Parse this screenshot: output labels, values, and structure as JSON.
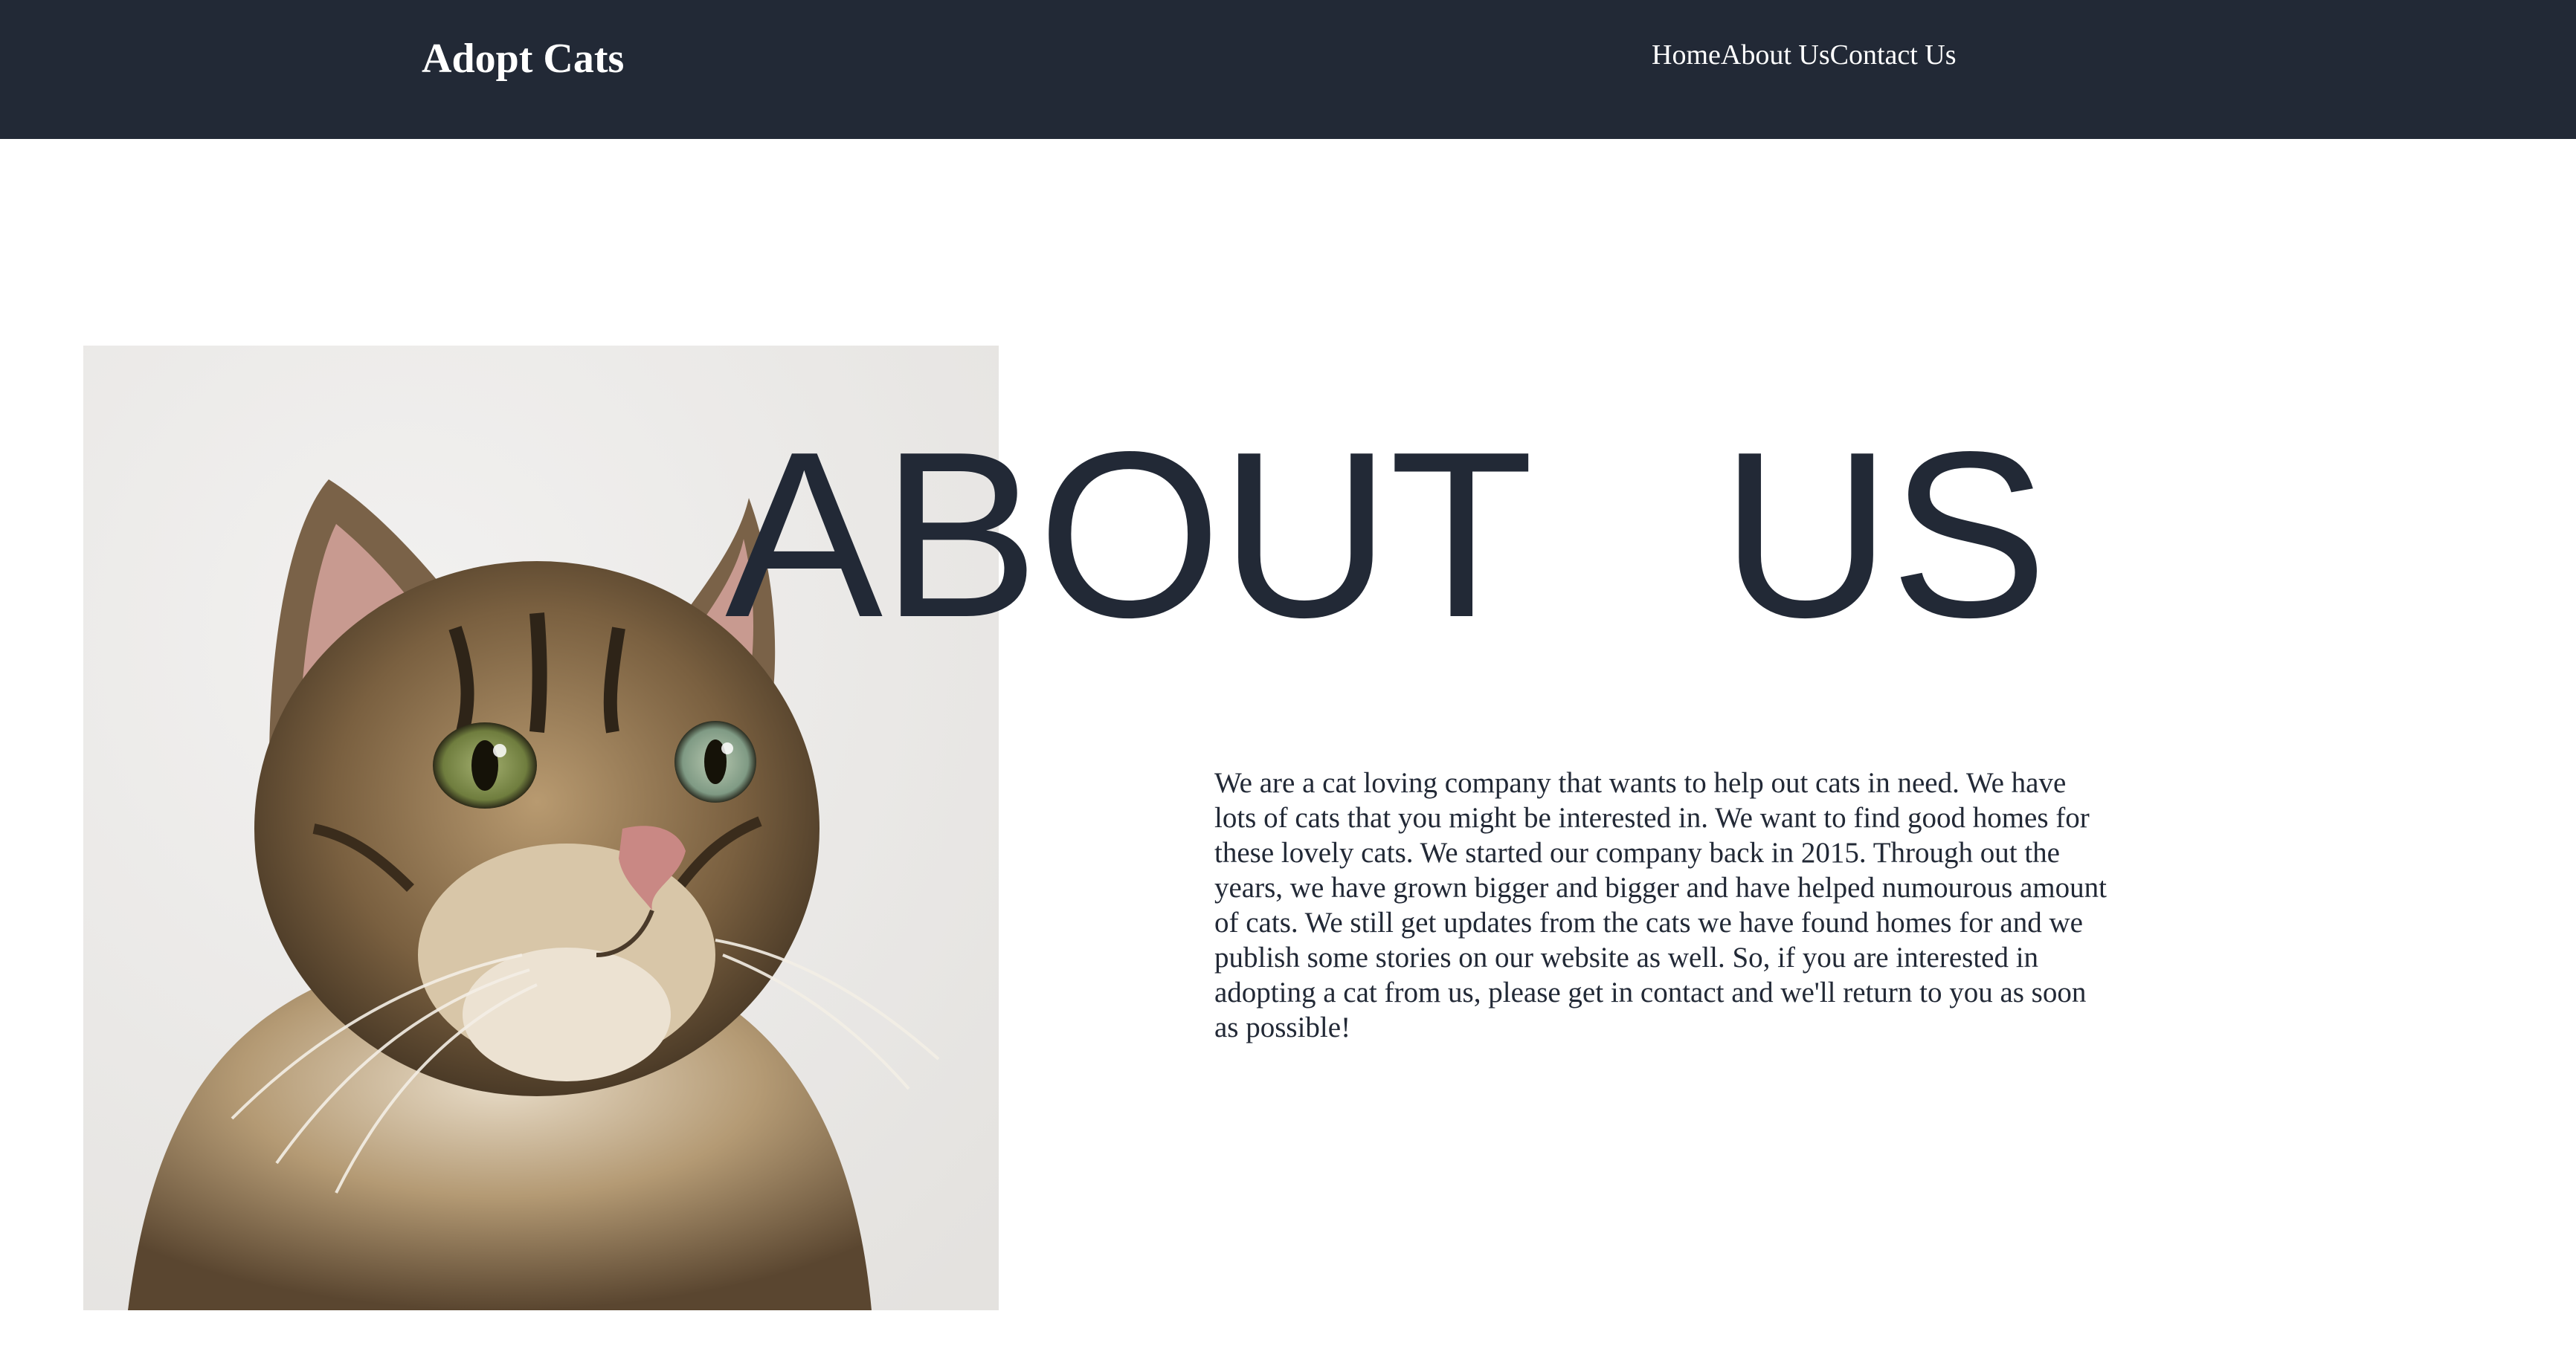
{
  "navbar": {
    "brand": "Adopt Cats",
    "links": [
      {
        "label": "Home"
      },
      {
        "label": "About Us"
      },
      {
        "label": "Contact Us"
      }
    ],
    "background_color": "#222936"
  },
  "hero": {
    "image_subject": "tabby cat looking up",
    "heading": "ABOUT   US"
  },
  "about": {
    "paragraph": "We are a cat loving company that wants to help out cats in need. We have lots of cats that you might be interested in. We want to find good homes for these lovely cats. We started our company back in 2015. Through out the years, we have grown bigger and bigger and have helped numourous amount of cats. We still get updates from the cats we have found homes for and we publish some stories on our website as well. So, if you are interested in adopting a cat from us, please get in contact and we'll return to you as soon as possible!"
  },
  "colors": {
    "text_dark": "#222936",
    "page_background": "#ffffff"
  }
}
